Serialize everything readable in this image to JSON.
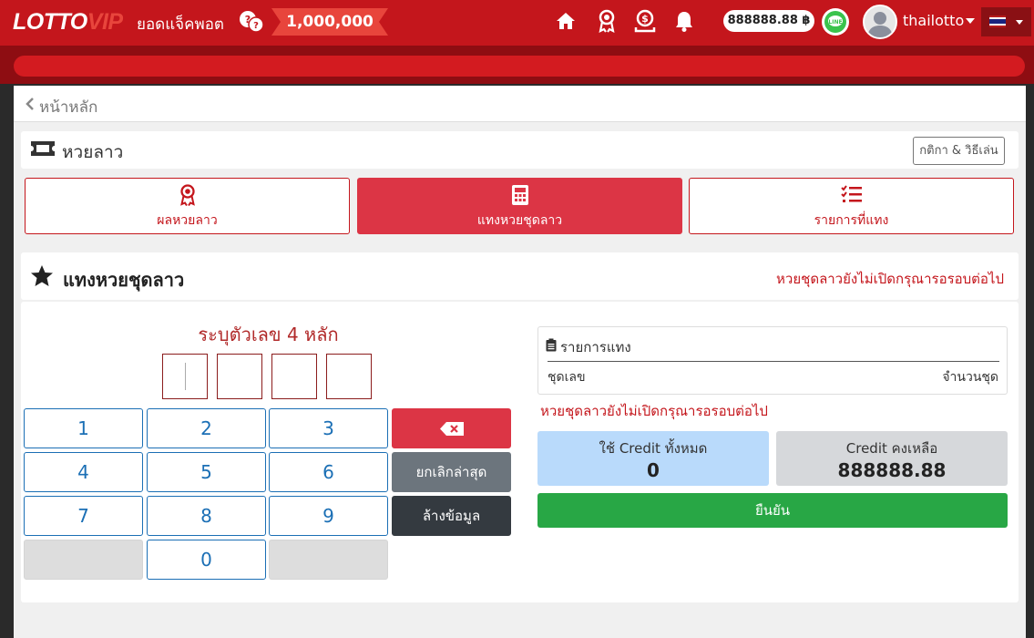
{
  "brand": {
    "logo_main": "LOTTO",
    "logo_accent": "VIP"
  },
  "jackpot": {
    "label": "ยอดแจ็คพอต",
    "value": "1,000,000"
  },
  "header": {
    "balance": "888888.88 ฿",
    "username": "thailotto"
  },
  "nav": {
    "back_label": "หน้าหลัก"
  },
  "page": {
    "title": "หวยลาว",
    "rules_button": "กติกา & วิธีเล่น"
  },
  "tabs": [
    {
      "label": "ผลหวยลาว",
      "icon": "award-icon"
    },
    {
      "label": "แทงหวยชุดลาว",
      "icon": "calculator-icon"
    },
    {
      "label": "รายการที่แทง",
      "icon": "checklist-icon"
    }
  ],
  "bet": {
    "title": "แทงหวยชุดลาว",
    "closed_message": "หวยชุดลาวยังไม่เปิดกรุณารอรอบต่อไป",
    "digit_prompt": "ระบุตัวเลข 4 หลัก"
  },
  "keypad": {
    "keys": [
      "1",
      "2",
      "3",
      "4",
      "5",
      "6",
      "7",
      "8",
      "9",
      "0"
    ],
    "cancel_last": "ยกเลิกล่าสุด",
    "clear_all": "ล้างข้อมูล"
  },
  "bet_list": {
    "title": "รายการแทง",
    "col_number": "ชุดเลข",
    "col_count": "จำนวนชุด"
  },
  "credit": {
    "used_label": "ใช้ Credit ทั้งหมด",
    "used_value": "0",
    "remaining_label": "Credit คงเหลือ",
    "remaining_value": "888888.88"
  },
  "confirm_label": "ยืนยัน",
  "colors": {
    "primary": "#c4161c",
    "active_tab": "#dc3545",
    "confirm": "#28a745",
    "key_text": "#1b6fb5"
  }
}
